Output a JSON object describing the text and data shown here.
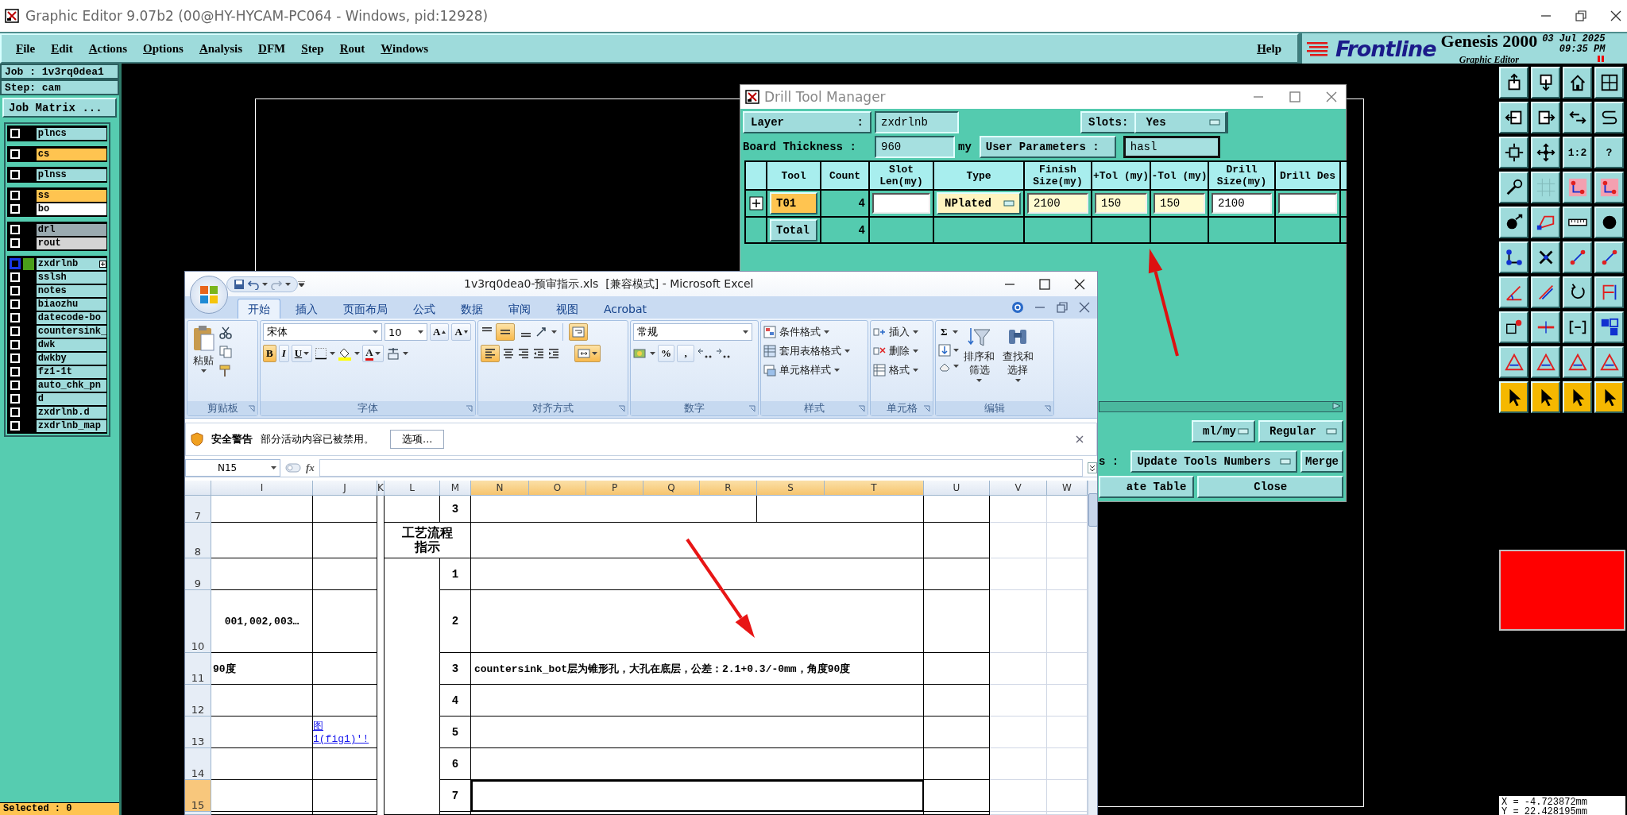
{
  "window": {
    "title": "Graphic Editor 9.07b2 (00@HY-HYCAM-PC064 - Windows, pid:12928)"
  },
  "menu": [
    "File",
    "Edit",
    "Actions",
    "Options",
    "Analysis",
    "DFM",
    "Step",
    "Rout",
    "Windows"
  ],
  "help": "Help",
  "brand": {
    "logo": "Frontline",
    "product": "Genesis 2000",
    "subtitle": "Graphic Editor",
    "date": "03 Jul 2025",
    "time": "09:35 PM"
  },
  "job": {
    "job": "Job : 1v3rq0dea1",
    "step": "Step: cam",
    "matrix_button": "Job Matrix ..."
  },
  "layer_groups": [
    {
      "layers": [
        {
          "name": "plncs",
          "color": "#a0dcdc",
          "checked": false,
          "selected": false
        }
      ]
    },
    {
      "layers": [
        {
          "name": "cs",
          "color": "#ffc450",
          "checked": false,
          "selected": false
        }
      ]
    },
    {
      "layers": [
        {
          "name": "plnss",
          "color": "#a0dcdc",
          "checked": false,
          "selected": false
        }
      ]
    },
    {
      "layers": [
        {
          "name": "ss",
          "color": "#ffc450",
          "checked": false,
          "selected": false
        },
        {
          "name": "bo",
          "color": "#ffffff",
          "checked": false,
          "selected": false
        }
      ]
    },
    {
      "layers": [
        {
          "name": "drl",
          "color": "#9aaab0",
          "checked": false,
          "selected": false
        },
        {
          "name": "rout",
          "color": "#d4d4d4",
          "checked": false,
          "selected": false
        }
      ]
    },
    {
      "layers": [
        {
          "name": "zxdrlnb",
          "color": "#a0dcdc",
          "checked": false,
          "selected": true
        },
        {
          "name": "sslsh",
          "color": "#a0dcdc",
          "checked": false,
          "selected": false
        },
        {
          "name": "notes",
          "color": "#a0dcdc",
          "checked": false,
          "selected": false
        },
        {
          "name": "biaozhu",
          "color": "#a0dcdc",
          "checked": false,
          "selected": false
        },
        {
          "name": "datecode-bo",
          "color": "#a0dcdc",
          "checked": false,
          "selected": false
        },
        {
          "name": "countersink_",
          "color": "#a0dcdc",
          "checked": false,
          "selected": false
        },
        {
          "name": "dwk",
          "color": "#a0dcdc",
          "checked": false,
          "selected": false
        },
        {
          "name": "dwkby",
          "color": "#a0dcdc",
          "checked": false,
          "selected": false
        },
        {
          "name": "fz1-1t",
          "color": "#a0dcdc",
          "checked": false,
          "selected": false
        },
        {
          "name": "auto_chk_pn",
          "color": "#a0dcdc",
          "checked": false,
          "selected": false
        },
        {
          "name": "d",
          "color": "#a0dcdc",
          "checked": false,
          "selected": false
        },
        {
          "name": "zxdrlnb.d",
          "color": "#a0dcdc",
          "checked": false,
          "selected": false
        },
        {
          "name": "zxdrlnb_map",
          "color": "#a0dcdc",
          "checked": false,
          "selected": false
        }
      ]
    }
  ],
  "selected_count": "Selected : 0",
  "toolbox": [
    {
      "kind": "export"
    },
    {
      "kind": "import"
    },
    {
      "kind": "home"
    },
    {
      "kind": "axes"
    },
    {
      "kind": "left"
    },
    {
      "kind": "right"
    },
    {
      "kind": "swap"
    },
    {
      "kind": "curve"
    },
    {
      "kind": "fit"
    },
    {
      "kind": "center"
    },
    {
      "kind": "text",
      "label": "1:2"
    },
    {
      "kind": "text",
      "label": "?"
    },
    {
      "kind": "props"
    },
    {
      "kind": "blank"
    },
    {
      "kind": "highlight"
    },
    {
      "kind": "highlight"
    },
    {
      "kind": "dot"
    },
    {
      "kind": "shape"
    },
    {
      "kind": "ruler"
    },
    {
      "kind": "disc"
    },
    {
      "kind": "nodes"
    },
    {
      "kind": "cross"
    },
    {
      "kind": "segment"
    },
    {
      "kind": "segment"
    },
    {
      "kind": "angle"
    },
    {
      "kind": "slash"
    },
    {
      "kind": "rotate"
    },
    {
      "kind": "flag"
    },
    {
      "kind": "point"
    },
    {
      "kind": "dash"
    },
    {
      "kind": "bracket"
    },
    {
      "kind": "squares"
    },
    {
      "kind": "triangle"
    },
    {
      "kind": "triangle"
    },
    {
      "kind": "triangle"
    },
    {
      "kind": "triangle"
    },
    {
      "kind": "pointer"
    },
    {
      "kind": "pointer"
    },
    {
      "kind": "pointer"
    },
    {
      "kind": "pointer"
    }
  ],
  "coordinates": {
    "x": "X = -4.723872mm",
    "y": "Y = 22.428195mm"
  },
  "drill_tool_manager": {
    "title": "Drill Tool Manager",
    "layer_label": "Layer",
    "layer_separator": ":",
    "layer": "zxdrlnb",
    "slots_label": "Slots:",
    "slots": "Yes",
    "thickness_label": "Board Thickness :",
    "thickness": "960",
    "thickness_unit": "my",
    "user_params_button": "User Parameters :",
    "user_params": "hasl",
    "columns": [
      "Tool",
      "Count",
      "Slot Len(my)",
      "Type",
      "Finish Size(my)",
      "+Tol (my)",
      "-Tol (my)",
      "Drill Size(my)",
      "Drill Des"
    ],
    "rows": [
      {
        "kind": "tool",
        "tool": "T01",
        "count": "4",
        "type": "NPlated",
        "finish": "2100",
        "plus_tol": "150",
        "minus_tol": "150",
        "drill": "2100"
      },
      {
        "kind": "total",
        "tool": "Total",
        "count": "4"
      }
    ],
    "units": "ml/my",
    "mode": "Regular",
    "renumber_label": "s :",
    "renumber": "Update Tools Numbers",
    "merge_button": "Merge",
    "update_button": "ate Table",
    "close_button": "Close"
  },
  "excel": {
    "title": "1v3rq0dea0-预审指示.xls  [兼容模式] - Microsoft Excel",
    "tabs": [
      {
        "label": "开始",
        "selected": true
      },
      {
        "label": "插入",
        "selected": false
      },
      {
        "label": "页面布局",
        "selected": false
      },
      {
        "label": "公式",
        "selected": false
      },
      {
        "label": "数据",
        "selected": false
      },
      {
        "label": "审阅",
        "selected": false
      },
      {
        "label": "视图",
        "selected": false
      },
      {
        "label": "Acrobat",
        "selected": false
      }
    ],
    "clipboard": {
      "label": "剪贴板",
      "paste": "粘贴"
    },
    "font": {
      "label": "字体",
      "font_name": "宋体",
      "font_size": "10",
      "grow": "A",
      "shrink": "A",
      "bold_label": "B",
      "italic_label": "I",
      "underline_label": "U",
      "bold": true,
      "color_label": "A"
    },
    "alignment": {
      "label": "对齐方式",
      "align_middle": true,
      "align_left": true,
      "wrap_text": true,
      "merge": true
    },
    "number": {
      "label": "数字",
      "format": "常规",
      "percent": "%",
      "comma": ","
    },
    "styles": {
      "label": "样式",
      "items": [
        "条件格式",
        "套用表格格式",
        "单元格样式"
      ]
    },
    "cells": {
      "label": "单元格",
      "items": [
        "插入",
        "删除",
        "格式"
      ]
    },
    "editing": {
      "label": "编辑",
      "sum": "Σ",
      "sort": "排序和筛选",
      "find": "查找和选择"
    },
    "security": {
      "title": "安全警告",
      "message": "部分活动内容已被禁用。",
      "button": "选项..."
    },
    "name_box": "N15",
    "function_label": "fx",
    "sheet": {
      "columns": [
        {
          "label": "I",
          "selected": false
        },
        {
          "label": "J",
          "selected": false
        },
        {
          "label": "K",
          "selected": false
        },
        {
          "label": "L",
          "selected": false
        },
        {
          "label": "M",
          "selected": false
        },
        {
          "label": "N",
          "selected": true
        },
        {
          "label": "O",
          "selected": true
        },
        {
          "label": "P",
          "selected": true
        },
        {
          "label": "Q",
          "selected": true
        },
        {
          "label": "R",
          "selected": true
        },
        {
          "label": "S",
          "selected": true
        },
        {
          "label": "T",
          "selected": true
        },
        {
          "label": "U",
          "selected": false
        },
        {
          "label": "V",
          "selected": false
        },
        {
          "label": "W",
          "selected": false
        }
      ],
      "rows": [
        {
          "label": "7",
          "selected": false,
          "column_m": "3"
        },
        {
          "label": "8",
          "selected": false,
          "column_l": "工艺流程指示"
        },
        {
          "label": "9",
          "selected": false,
          "column_m": "1"
        },
        {
          "label": "10",
          "selected": false,
          "column_i": "001,002,003…",
          "column_m": "2"
        },
        {
          "label": "11",
          "selected": false,
          "column_i": "90度",
          "column_m": "3",
          "column_n": "countersink_bot层为锥形孔，大孔在底层，公差：2.1+0.3/-0mm，角度90度"
        },
        {
          "label": "12",
          "selected": false,
          "column_m": "4"
        },
        {
          "label": "13",
          "selected": false,
          "column_j": "图 1(fig1)'!",
          "column_m": "5"
        },
        {
          "label": "14",
          "selected": false,
          "column_m": "6"
        },
        {
          "label": "15",
          "selected": true,
          "column_m": "7"
        }
      ]
    }
  }
}
